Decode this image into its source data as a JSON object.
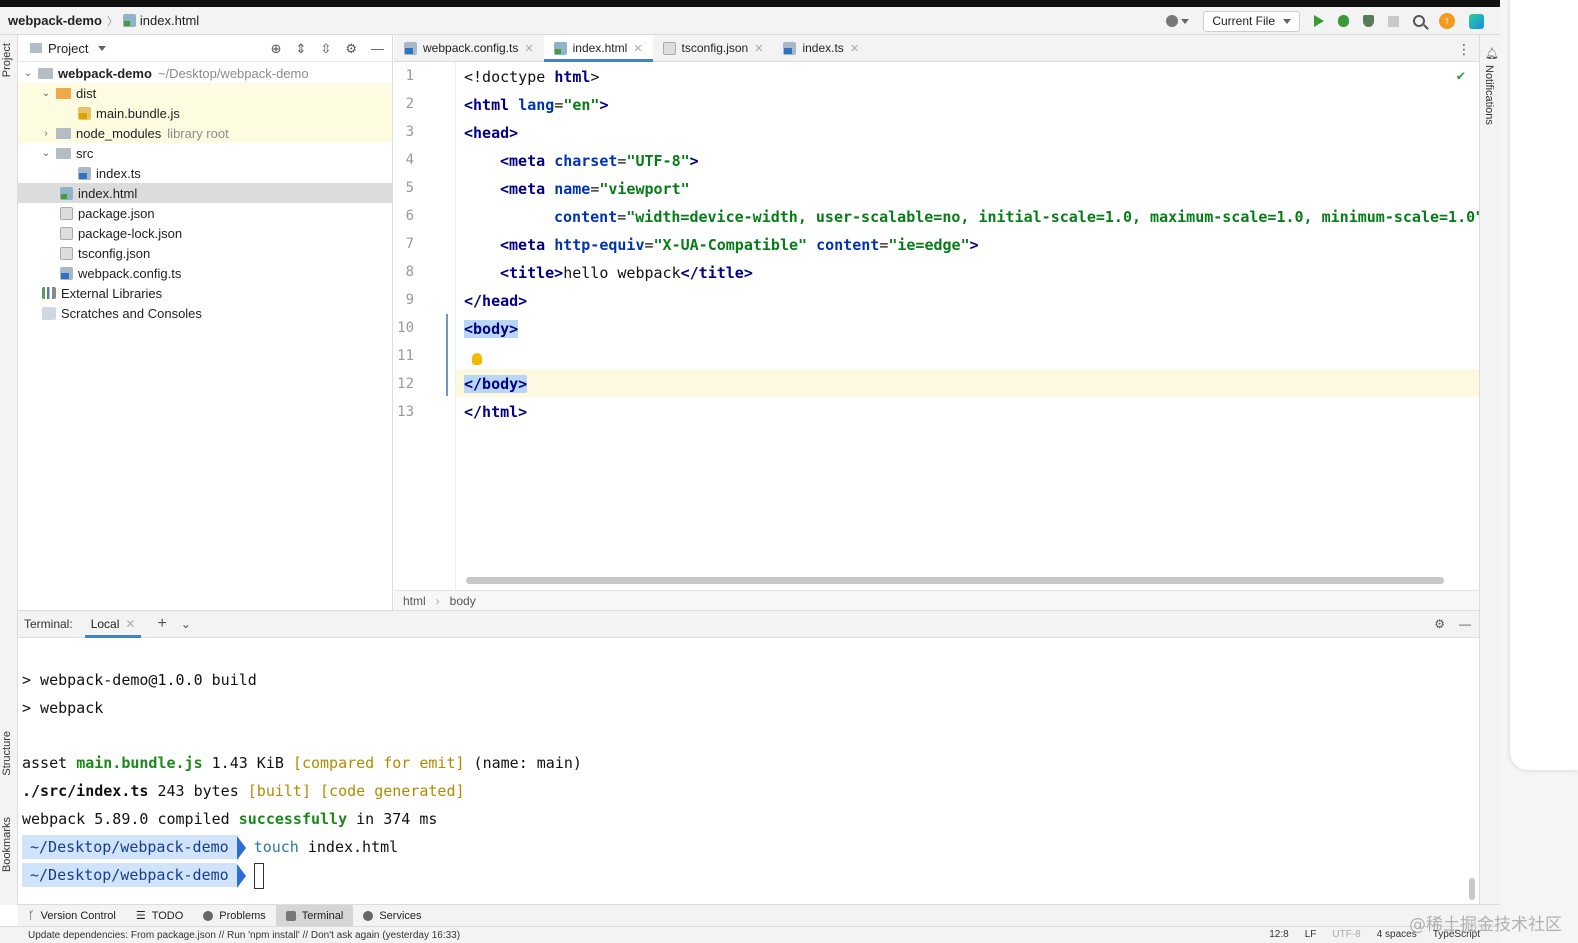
{
  "navbar": {
    "project": "webpack-demo",
    "file": "index.html",
    "run_config": "Current File"
  },
  "left_stripe": {
    "project": "Project",
    "structure": "Structure",
    "bookmarks": "Bookmarks"
  },
  "project_panel": {
    "title": "Project",
    "tree": [
      {
        "label": "webpack-demo",
        "suffix": "~/Desktop/webpack-demo",
        "level": 0,
        "icon": "folder-icon"
      },
      {
        "label": "dist",
        "suffix": "",
        "level": 1,
        "icon": "folder-icon"
      },
      {
        "label": "main.bundle.js",
        "suffix": "",
        "level": 2,
        "icon": "js-file-icon"
      },
      {
        "label": "node_modules",
        "suffix": "library root",
        "level": 1,
        "icon": "folder-icon"
      },
      {
        "label": "src",
        "suffix": "",
        "level": 1,
        "icon": "folder-icon"
      },
      {
        "label": "index.ts",
        "suffix": "",
        "level": 2,
        "icon": "ts-file-icon"
      },
      {
        "label": "index.html",
        "suffix": "",
        "level": 1,
        "icon": "html-file-icon"
      },
      {
        "label": "package.json",
        "suffix": "",
        "level": 1,
        "icon": "json-file-icon"
      },
      {
        "label": "package-lock.json",
        "suffix": "",
        "level": 1,
        "icon": "json-file-icon"
      },
      {
        "label": "tsconfig.json",
        "suffix": "",
        "level": 1,
        "icon": "json-file-icon"
      },
      {
        "label": "webpack.config.ts",
        "suffix": "",
        "level": 1,
        "icon": "ts-file-icon"
      },
      {
        "label": "External Libraries",
        "suffix": "",
        "level": 0,
        "icon": "libraries-icon"
      },
      {
        "label": "Scratches and Consoles",
        "suffix": "",
        "level": 0,
        "icon": "scratches-icon"
      }
    ]
  },
  "editor_tabs": [
    {
      "label": "webpack.config.ts",
      "active": false
    },
    {
      "label": "index.html",
      "active": true
    },
    {
      "label": "tsconfig.json",
      "active": false
    },
    {
      "label": "index.ts",
      "active": false
    }
  ],
  "editor": {
    "line_numbers": [
      "1",
      "2",
      "3",
      "4",
      "5",
      "6",
      "7",
      "8",
      "9",
      "10",
      "11",
      "12",
      "13"
    ],
    "lines": {
      "l1_a": "<!doctype ",
      "l1_b": "html",
      "l1_c": ">",
      "l2_a": "<html ",
      "l2_b": "lang",
      "l2_c": "=",
      "l2_d": "\"en\"",
      "l2_e": ">",
      "l3": "<head>",
      "l4_a": "<meta ",
      "l4_b": "charset",
      "l4_c": "=",
      "l4_d": "\"UTF-8\"",
      "l4_e": ">",
      "l5_a": "<meta ",
      "l5_b": "name",
      "l5_c": "=",
      "l5_d": "\"viewport\"",
      "l6_a": "content",
      "l6_b": "=",
      "l6_c": "\"width=device-width, user-scalable=no, initial-scale=1.0, maximum-scale=1.0, minimum-scale=1.0\"",
      "l6_d": ">",
      "l7_a": "<meta ",
      "l7_b": "http-equiv",
      "l7_c": "=",
      "l7_d": "\"X-UA-Compatible\"",
      "l7_e": " ",
      "l7_f": "content",
      "l7_g": "=",
      "l7_h": "\"ie=edge\"",
      "l7_i": ">",
      "l8_a": "<title>",
      "l8_b": "hello webpack",
      "l8_c": "</title>",
      "l9": "</head>",
      "l10": "<body>",
      "l12": "</body>",
      "l13": "</html>"
    }
  },
  "editor_crumbs": [
    "html",
    "body"
  ],
  "right_stripe": {
    "notifications": "Notifications"
  },
  "terminal": {
    "title": "Terminal:",
    "tab": "Local",
    "lines": {
      "t1": "> webpack-demo@1.0.0 build",
      "t2": "> webpack",
      "t3_a": "asset ",
      "t3_b": "main.bundle.js",
      "t3_c": " 1.43 KiB ",
      "t3_d": "[compared for emit]",
      "t3_e": " (name: main)",
      "t4_a": "./src/index.ts",
      "t4_b": " 243 bytes ",
      "t4_c": "[built]",
      "t4_d": " ",
      "t4_e": "[code generated]",
      "t5_a": "webpack 5.89.0 compiled ",
      "t5_b": "successfully",
      "t5_c": " in 374 ms",
      "p1": "~/Desktop/webpack-demo",
      "c1_a": "touch",
      "c1_b": " index.html",
      "p2": "~/Desktop/webpack-demo"
    }
  },
  "bottom_tools": [
    {
      "label": "Version Control",
      "active": false
    },
    {
      "label": "TODO",
      "active": false
    },
    {
      "label": "Problems",
      "active": false
    },
    {
      "label": "Terminal",
      "active": true
    },
    {
      "label": "Services",
      "active": false
    }
  ],
  "statusbar": {
    "message": "Update dependencies: From package.json // Run 'npm install' // Don't ask again (yesterday 16:33)",
    "position": "12:8",
    "line_sep": "LF",
    "encoding": "UTF-8",
    "indent": "4 spaces",
    "language": "TypeScript"
  },
  "watermark": "@稀土掘金技术社区"
}
